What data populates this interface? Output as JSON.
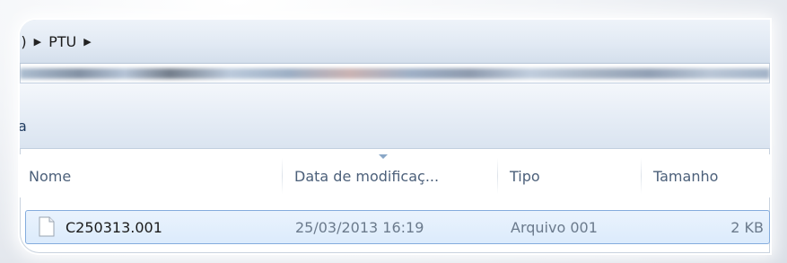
{
  "address_bar": {
    "crumbs": [
      ":)",
      "PTU"
    ]
  },
  "toolbar": {
    "label": "a"
  },
  "columns": [
    {
      "label": "Nome"
    },
    {
      "label": "Data de modificaç..."
    },
    {
      "label": "Tipo"
    },
    {
      "label": "Tamanho"
    }
  ],
  "files": [
    {
      "name": "C250313.001",
      "modified": "25/03/2013 16:19",
      "type": "Arquivo 001",
      "size": "2 KB",
      "icon": "file-icon"
    }
  ],
  "colors": {
    "selection_bg": "#dcebfc",
    "selection_border": "#84acdd",
    "header_text": "#4c607a",
    "name_text": "#1b1b1b",
    "secondary_text": "#6b7a8c"
  }
}
